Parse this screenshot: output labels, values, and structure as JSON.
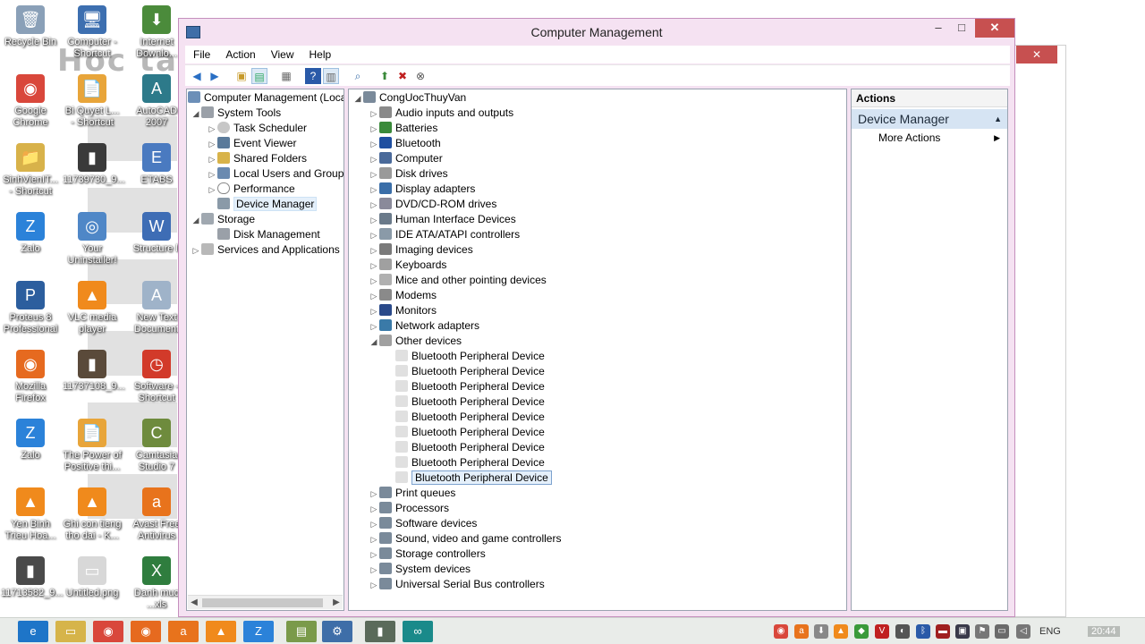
{
  "window": {
    "title": "Computer Management",
    "buttons": {
      "minimize": "–",
      "maximize": "□",
      "close": "✕"
    }
  },
  "menu": [
    "File",
    "Action",
    "View",
    "Help"
  ],
  "left_tree": {
    "root": "Computer Management (Local",
    "system_tools": "System Tools",
    "task_scheduler": "Task Scheduler",
    "event_viewer": "Event Viewer",
    "shared_folders": "Shared Folders",
    "local_users": "Local Users and Groups",
    "performance": "Performance",
    "device_manager": "Device Manager",
    "storage": "Storage",
    "disk_management": "Disk Management",
    "services_apps": "Services and Applications"
  },
  "device_tree": {
    "computer_name": "CongUocThuyVan",
    "categories": [
      "Audio inputs and outputs",
      "Batteries",
      "Bluetooth",
      "Computer",
      "Disk drives",
      "Display adapters",
      "DVD/CD-ROM drives",
      "Human Interface Devices",
      "IDE ATA/ATAPI controllers",
      "Imaging devices",
      "Keyboards",
      "Mice and other pointing devices",
      "Modems",
      "Monitors",
      "Network adapters",
      "Other devices"
    ],
    "other_devices": [
      "Bluetooth Peripheral Device",
      "Bluetooth Peripheral Device",
      "Bluetooth Peripheral Device",
      "Bluetooth Peripheral Device",
      "Bluetooth Peripheral Device",
      "Bluetooth Peripheral Device",
      "Bluetooth Peripheral Device",
      "Bluetooth Peripheral Device",
      "Bluetooth Peripheral Device"
    ],
    "categories_after": [
      "Print queues",
      "Processors",
      "Software devices",
      "Sound, video and game controllers",
      "Storage controllers",
      "System devices",
      "Universal Serial Bus controllers"
    ]
  },
  "actions": {
    "header": "Actions",
    "section": "Device Manager",
    "more": "More Actions"
  },
  "desktop_icons": [
    {
      "label": "Recycle Bin",
      "color": "#8aa0b8",
      "glyph": "🗑"
    },
    {
      "label": "Computer - Shortcut",
      "color": "#3d6fb0",
      "glyph": "🖥"
    },
    {
      "label": "Internet Downlo...",
      "color": "#4b8b3b",
      "glyph": "⬇"
    },
    {
      "label": "Google Chrome",
      "color": "#d9473b",
      "glyph": "◉"
    },
    {
      "label": "Bi Quyet L... - Shortcut",
      "color": "#e8a53a",
      "glyph": "📄"
    },
    {
      "label": "AutoCAD 2007",
      "color": "#2d7a8a",
      "glyph": "A"
    },
    {
      "label": "SinhVienIT... - Shortcut",
      "color": "#d8b24a",
      "glyph": "📁"
    },
    {
      "label": "11739730_9...",
      "color": "#3a3a3a",
      "glyph": "▮"
    },
    {
      "label": "ETABS",
      "color": "#4a7ac0",
      "glyph": "E"
    },
    {
      "label": "Zalo",
      "color": "#2b82d9",
      "glyph": "Z"
    },
    {
      "label": "Your Uninstaller!",
      "color": "#4f87c7",
      "glyph": "◎"
    },
    {
      "label": "Structure li",
      "color": "#3e6db5",
      "glyph": "W"
    },
    {
      "label": "Proteus 8 Professional",
      "color": "#2c5e9e",
      "glyph": "P"
    },
    {
      "label": "VLC media player",
      "color": "#f08a1c",
      "glyph": "▲"
    },
    {
      "label": "New Text Document",
      "color": "#9fb3c9",
      "glyph": "A"
    },
    {
      "label": "Mozilla Firefox",
      "color": "#e66a1f",
      "glyph": "◉"
    },
    {
      "label": "11737108_9...",
      "color": "#5a4a3a",
      "glyph": "▮"
    },
    {
      "label": "Software - Shortcut",
      "color": "#d23a2a",
      "glyph": "◷"
    },
    {
      "label": "Zalo",
      "color": "#2b82d9",
      "glyph": "Z"
    },
    {
      "label": "The Power of Positive thi...",
      "color": "#e8a53a",
      "glyph": "📄"
    },
    {
      "label": "Camtasia Studio 7",
      "color": "#6e8b3d",
      "glyph": "C"
    },
    {
      "label": "Yen Binh Trieu Hoa...",
      "color": "#f08a1c",
      "glyph": "▲"
    },
    {
      "label": "Ghi con tieng tho dai - K...",
      "color": "#f08a1c",
      "glyph": "▲"
    },
    {
      "label": "Avast Free Antivirus",
      "color": "#e8731c",
      "glyph": "a"
    },
    {
      "label": "11713582_9...",
      "color": "#4a4a4a",
      "glyph": "▮"
    },
    {
      "label": "Untitled.png",
      "color": "#d8d8d8",
      "glyph": "▭"
    },
    {
      "label": "Danh muc ...xls",
      "color": "#2f7d3e",
      "glyph": "X"
    }
  ],
  "desktop_watermark": "Hoc tap",
  "taskbar": {
    "lang": "ENG",
    "time": "20:44"
  }
}
